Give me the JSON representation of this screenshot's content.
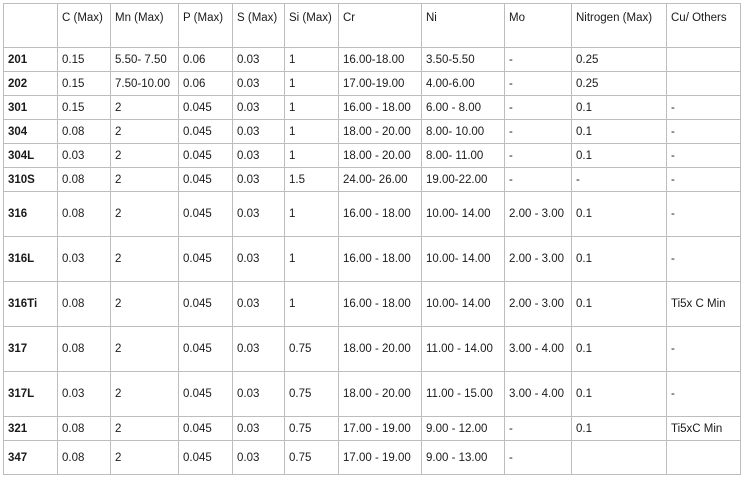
{
  "headers": [
    "",
    "C (Max)",
    "Mn (Max)",
    "P (Max)",
    "S (Max)",
    "Si (Max)",
    "Cr",
    "Ni",
    "Mo",
    "Nitrogen (Max)",
    "Cu/ Others"
  ],
  "rows": [
    [
      "201",
      "0.15",
      "5.50- 7.50",
      "0.06",
      "0.03",
      "1",
      "16.00-18.00",
      "3.50-5.50",
      "-",
      "0.25",
      ""
    ],
    [
      "202",
      "0.15",
      "7.50-10.00",
      "0.06",
      "0.03",
      "1",
      "17.00-19.00",
      "4.00-6.00",
      "-",
      "0.25",
      ""
    ],
    [
      "301",
      "0.15",
      "2",
      "0.045",
      "0.03",
      "1",
      "16.00 - 18.00",
      "6.00 - 8.00",
      "-",
      "0.1",
      "-"
    ],
    [
      "304",
      "0.08",
      "2",
      "0.045",
      "0.03",
      "1",
      "18.00 - 20.00",
      "8.00- 10.00",
      "-",
      "0.1",
      "-"
    ],
    [
      "304L",
      "0.03",
      "2",
      "0.045",
      "0.03",
      "1",
      "18.00 - 20.00",
      "8.00- 11.00",
      "-",
      "0.1",
      "-"
    ],
    [
      "310S",
      "0.08",
      "2",
      "0.045",
      "0.03",
      "1.5",
      "24.00- 26.00",
      "19.00-22.00",
      "-",
      "-",
      "-"
    ],
    [
      "316",
      "0.08",
      "2",
      "0.045",
      "0.03",
      "1",
      "16.00 - 18.00",
      "10.00- 14.00",
      "2.00 - 3.00",
      "0.1",
      "-"
    ],
    [
      "316L",
      "0.03",
      "2",
      "0.045",
      "0.03",
      "1",
      "16.00 - 18.00",
      "10.00- 14.00",
      "2.00 - 3.00",
      "0.1",
      "-"
    ],
    [
      "316Ti",
      "0.08",
      "2",
      "0.045",
      "0.03",
      "1",
      "16.00 - 18.00",
      "10.00- 14.00",
      "2.00 - 3.00",
      "0.1",
      "Ti5x C Min"
    ],
    [
      "317",
      "0.08",
      "2",
      "0.045",
      "0.03",
      "0.75",
      "18.00 - 20.00",
      "11.00 - 14.00",
      "3.00 - 4.00",
      "0.1",
      "-"
    ],
    [
      "317L",
      "0.03",
      "2",
      "0.045",
      "0.03",
      "0.75",
      "18.00 - 20.00",
      "11.00 - 15.00",
      "3.00 - 4.00",
      "0.1",
      "-"
    ],
    [
      "321",
      "0.08",
      "2",
      "0.045",
      "0.03",
      "0.75",
      "17.00 - 19.00",
      "9.00 - 12.00",
      "-",
      "0.1",
      "Ti5xC Min"
    ],
    [
      "347",
      "0.08",
      "2",
      "0.045",
      "0.03",
      "0.75",
      "17.00 - 19.00",
      "9.00 - 13.00",
      "-",
      "",
      ""
    ]
  ]
}
